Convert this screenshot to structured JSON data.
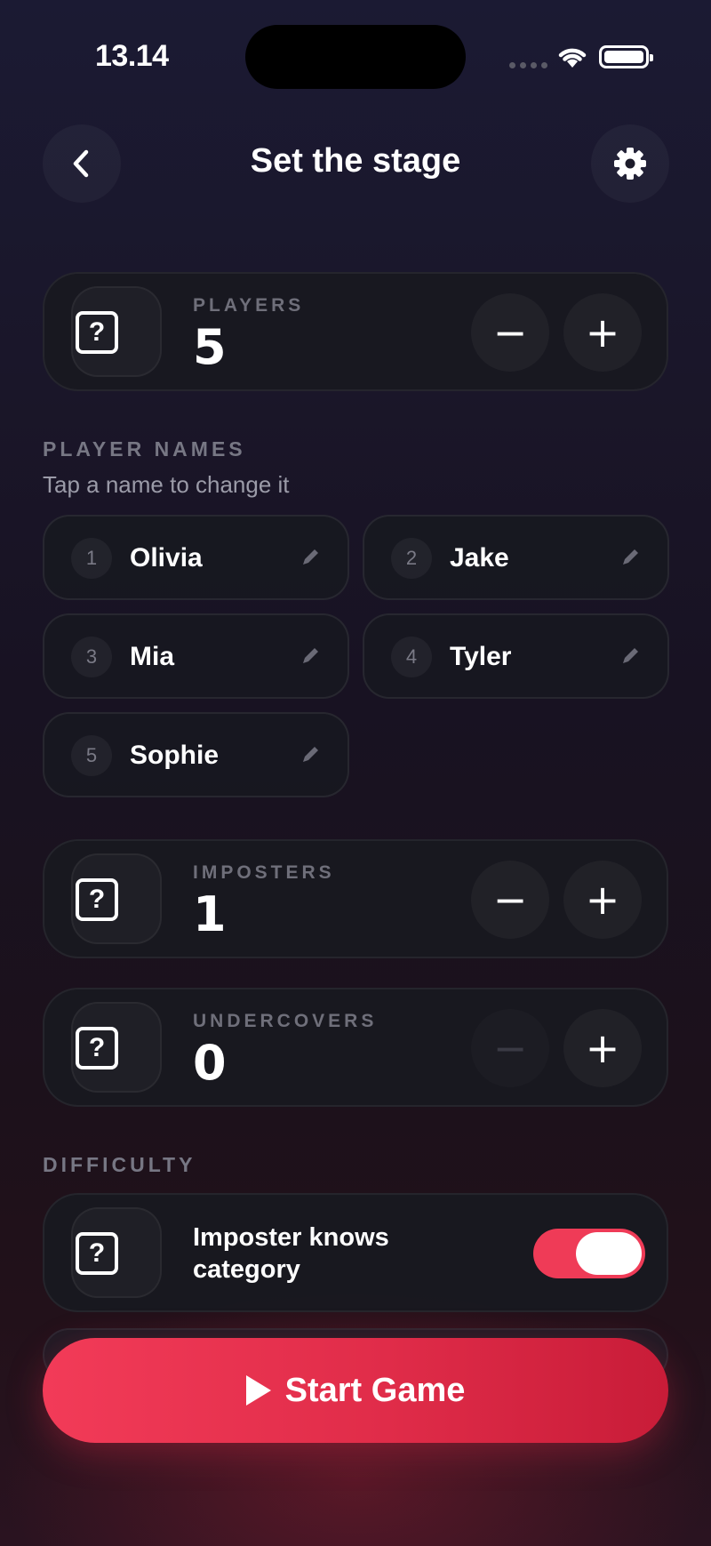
{
  "status_bar": {
    "time": "13.14"
  },
  "header": {
    "title": "Set the stage",
    "back_icon": "chevron-left-icon",
    "settings_icon": "gear-icon"
  },
  "players": {
    "label": "PLAYERS",
    "value": "5"
  },
  "player_names": {
    "label": "PLAYER NAMES",
    "hint": "Tap a name to change it",
    "items": [
      {
        "num": "1",
        "name": "Olivia"
      },
      {
        "num": "2",
        "name": "Jake"
      },
      {
        "num": "3",
        "name": "Mia"
      },
      {
        "num": "4",
        "name": "Tyler"
      },
      {
        "num": "5",
        "name": "Sophie"
      }
    ]
  },
  "imposters": {
    "label": "IMPOSTERS",
    "value": "1"
  },
  "undercovers": {
    "label": "UNDERCOVERS",
    "value": "0",
    "minus_disabled": true
  },
  "stepper": {
    "minus": "−",
    "plus": "+"
  },
  "difficulty": {
    "label": "DIFFICULTY",
    "imposter_knows_category": {
      "line1": "Imposter knows",
      "line2": "category",
      "enabled": true
    }
  },
  "icon_placeholder": "?",
  "start_button": {
    "label": "Start Game",
    "icon": "play-icon"
  },
  "colors": {
    "accent": "#ef3b57",
    "background": "#1a1629"
  }
}
